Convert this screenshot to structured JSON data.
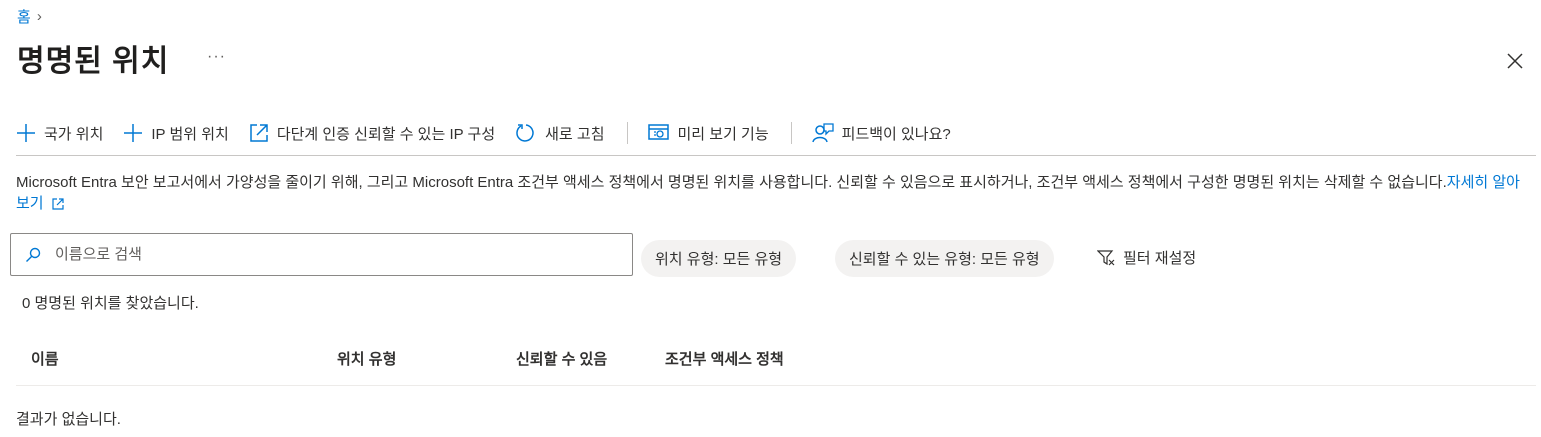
{
  "breadcrumb": {
    "home": "홈",
    "separator": "›"
  },
  "page": {
    "title": "명명된 위치",
    "more": "···"
  },
  "toolbar": {
    "country_location": "국가 위치",
    "ip_range_location": "IP 범위 위치",
    "mfa_trusted_ips": "다단계 인증 신뢰할 수 있는 IP 구성",
    "refresh": "새로 고침",
    "preview_features": "미리 보기 기능",
    "feedback": "피드백이 있나요?"
  },
  "info": {
    "text": "Microsoft Entra 보안 보고서에서 가양성을 줄이기 위해, 그리고 Microsoft Entra 조건부 액세스 정책에서 명명된 위치를 사용합니다. 신뢰할 수 있음으로 표시하거나, 조건부 액세스 정책에서 구성한 명명된 위치는 삭제할 수 없습니다.",
    "link": "자세히 알아보기"
  },
  "search": {
    "placeholder": "이름으로 검색",
    "value": ""
  },
  "filters": {
    "location_type": "위치 유형: 모든 유형",
    "trusted_type": "신뢰할 수 있는 유형: 모든 유형",
    "reset": "필터 재설정"
  },
  "results": {
    "count_text": "0 명명된 위치를 찾았습니다.",
    "empty_text": "결과가 없습니다."
  },
  "table": {
    "columns": [
      "이름",
      "위치 유형",
      "신뢰할 수 있음",
      "조건부 액세스 정책"
    ]
  },
  "colors": {
    "accent": "#0078d4",
    "text": "#323130",
    "pill_bg": "#f3f2f1",
    "border": "#8a8886"
  }
}
